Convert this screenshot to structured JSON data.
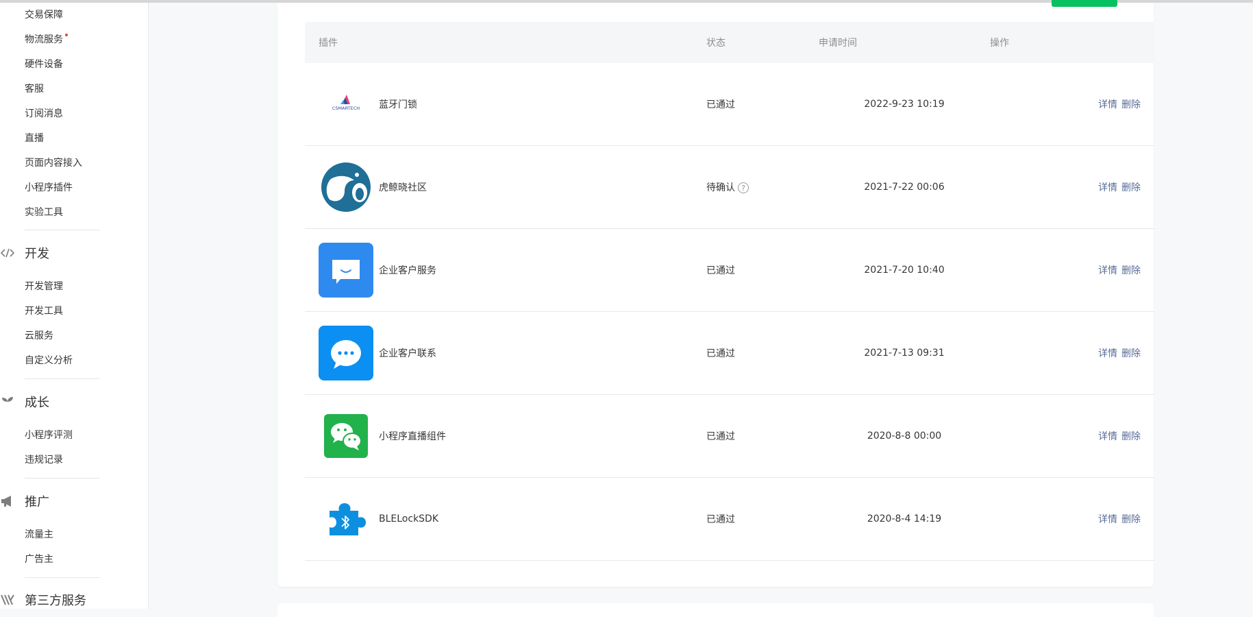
{
  "sidebar": {
    "items_group1": [
      "交易保障",
      "物流服务",
      "硬件设备",
      "客服",
      "订阅消息",
      "直播",
      "页面内容接入",
      "小程序插件",
      "实验工具"
    ],
    "dev": {
      "title": "开发",
      "items": [
        "开发管理",
        "开发工具",
        "云服务",
        "自定义分析"
      ]
    },
    "growth": {
      "title": "成长",
      "items": [
        "小程序评测",
        "违规记录"
      ]
    },
    "promo": {
      "title": "推广",
      "items": [
        "流量主",
        "广告主"
      ]
    },
    "third": {
      "title": "第三方服务"
    }
  },
  "table": {
    "headers": {
      "plugin": "插件",
      "status": "状态",
      "time": "申请时间",
      "ops": "操作"
    },
    "rows": [
      {
        "name": "蓝牙门锁",
        "status": "已通过",
        "time": "2022-9-23 10:19",
        "detail": "详情",
        "delete": "删除",
        "logo_text": "CSMARTECH"
      },
      {
        "name": "虎鲸晓社区",
        "status": "待确认",
        "time": "2021-7-22 00:06",
        "detail": "详情",
        "delete": "删除"
      },
      {
        "name": "企业客户服务",
        "status": "已通过",
        "time": "2021-7-20 10:40",
        "detail": "详情",
        "delete": "删除"
      },
      {
        "name": "企业客户联系",
        "status": "已通过",
        "time": "2021-7-13 09:31",
        "detail": "详情",
        "delete": "删除"
      },
      {
        "name": "小程序直播组件",
        "status": "已通过",
        "time": "2020-8-8 00:00",
        "detail": "详情",
        "delete": "删除"
      },
      {
        "name": "BLELockSDK",
        "status": "已通过",
        "time": "2020-8-4 14:19",
        "detail": "详情",
        "delete": "删除"
      }
    ]
  },
  "colors": {
    "link": "#576b95",
    "accent_green": "#07c160",
    "new_dot": "#e64340"
  }
}
